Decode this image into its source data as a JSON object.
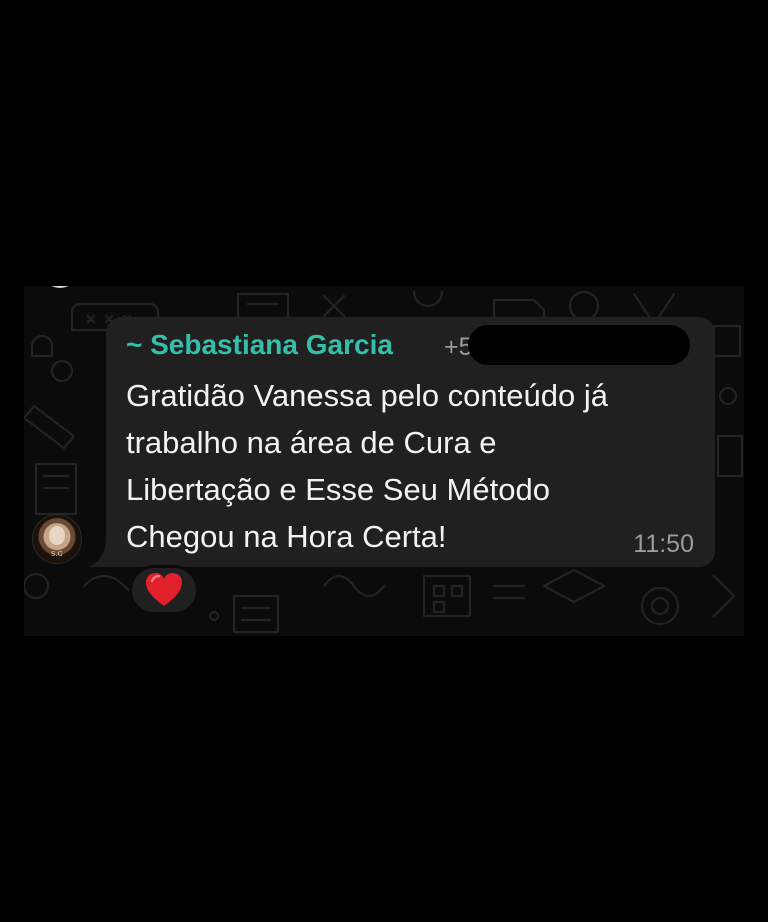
{
  "message": {
    "sender": "~ Sebastiana Garcia",
    "phone_visible": "+5",
    "body": "Gratidão Vanessa pelo conteúdo já\ntrabalho na área de Cura e\nLibertação e Esse Seu Método\nChegou na Hora Certa!",
    "time": "11:50",
    "avatar_initials": "S.G",
    "reaction_icon": "red-heart-icon"
  },
  "colors": {
    "sender_name": "#35bfa8",
    "bubble": "#202020",
    "background": "#0b0b0b",
    "heart": "#e0202a"
  }
}
